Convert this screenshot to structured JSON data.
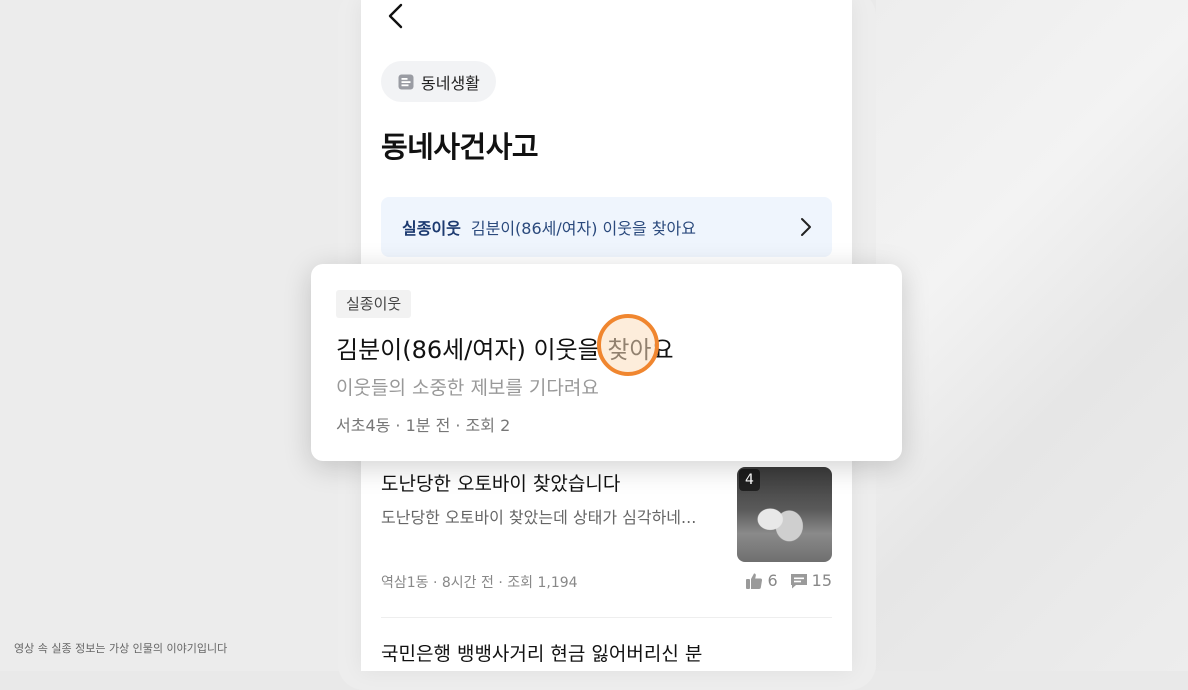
{
  "header": {
    "back_icon": "chevron-left-icon"
  },
  "category_chip": {
    "icon": "board-icon",
    "label": "동네생활"
  },
  "page_title": "동네사건사고",
  "banner": {
    "tag": "실종이웃",
    "text": "김분이(86세/여자) 이웃을 찾아요",
    "icon": "chevron-right-icon"
  },
  "popup_card": {
    "tag": "실종이웃",
    "title": "김분이(86세/여자) 이웃을 찾아요",
    "subtitle": "이웃들의 소중한 제보를 기다려요",
    "meta": "서초4동 · 1분 전 · 조회 2"
  },
  "feed": [
    {
      "title": "도난당한 오토바이 찾았습니다",
      "snippet": "도난당한 오토바이 찾았는데 상태가 심각하네...",
      "meta": "역삼1동 · 8시간 전 · 조회 1,194",
      "image_count": "4",
      "likes": "6",
      "comments": "15"
    },
    {
      "title": "국민은행 뱅뱅사거리 현금 잃어버리신 분"
    }
  ],
  "disclaimer": "영상 속 실종 정보는 가상 인물의 이야기입니다",
  "colors": {
    "accent": "#f0862f",
    "banner_bg": "#eff5fd",
    "banner_tag": "#1c3a70"
  }
}
